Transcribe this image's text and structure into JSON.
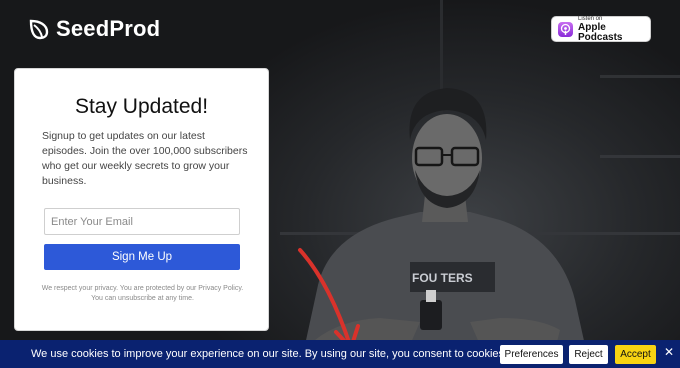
{
  "brand": {
    "name": "SeedProd"
  },
  "podcast_badge": {
    "small": "Listen on",
    "big": "Apple Podcasts"
  },
  "signup": {
    "title": "Stay Updated!",
    "description": "Signup to get updates on our latest episodes. Join the over 100,000 subscribers who get our weekly secrets to grow your business.",
    "email_placeholder": "Enter Your Email",
    "button_label": "Sign Me Up",
    "privacy": "We respect your privacy. You are protected by our Privacy Policy. You can unsubscribe at any time."
  },
  "cookie_bar": {
    "message": "We use cookies to improve your experience on our site. By using our site, you consent to cookies.",
    "preferences_label": "Preferences",
    "reject_label": "Reject",
    "accept_label": "Accept",
    "close_label": "✕"
  },
  "colors": {
    "cookie_bar": "#0a2270",
    "accept": "#f7d313",
    "primary_button": "#2d59d8",
    "arrow": "#d9322b"
  }
}
